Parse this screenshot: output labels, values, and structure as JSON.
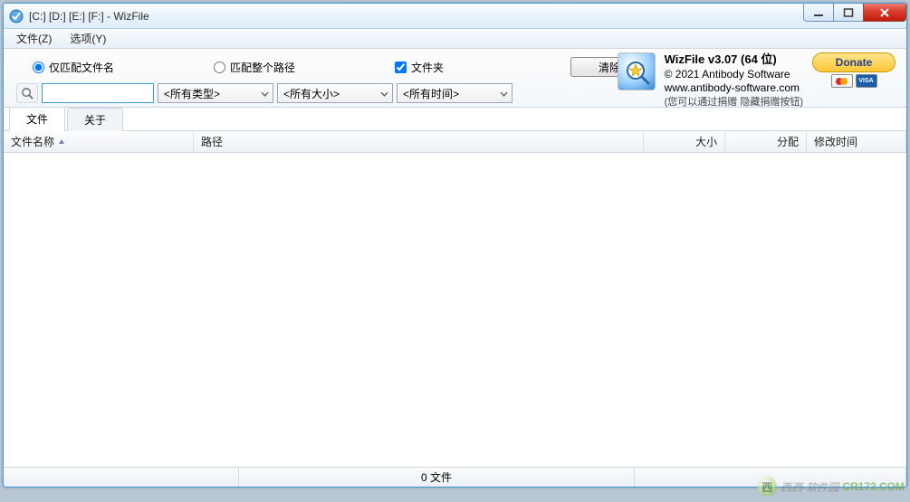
{
  "window": {
    "title": "[C:] [D:] [E:] [F:]  - WizFile"
  },
  "menubar": {
    "file": "文件(Z)",
    "options": "选项(Y)"
  },
  "filter": {
    "match_filename_only": "仅匹配文件名",
    "match_full_path": "匹配整个路径",
    "folders_checkbox": "文件夹",
    "clear_button": "清除",
    "search_value": "",
    "type_combo": "<所有类型>",
    "size_combo": "<所有大小>",
    "time_combo": "<所有时间>"
  },
  "app_info": {
    "name": "WizFile v3.07 (64 位)",
    "copyright": "© 2021 Antibody Software",
    "website": "www.antibody-software.com",
    "hint": "(您可以通过捐赠 隐藏捐赠按钮)"
  },
  "donate": {
    "label": "Donate",
    "card_visa": "VISA"
  },
  "tabs": {
    "files": "文件",
    "about": "关于"
  },
  "columns": {
    "name": "文件名称",
    "path": "路径",
    "size": "大小",
    "alloc": "分配",
    "mtime": "修改时间"
  },
  "status": {
    "count": "0 文件"
  },
  "watermark": {
    "text": "西西·软件园",
    "domain": "CR173.COM"
  }
}
